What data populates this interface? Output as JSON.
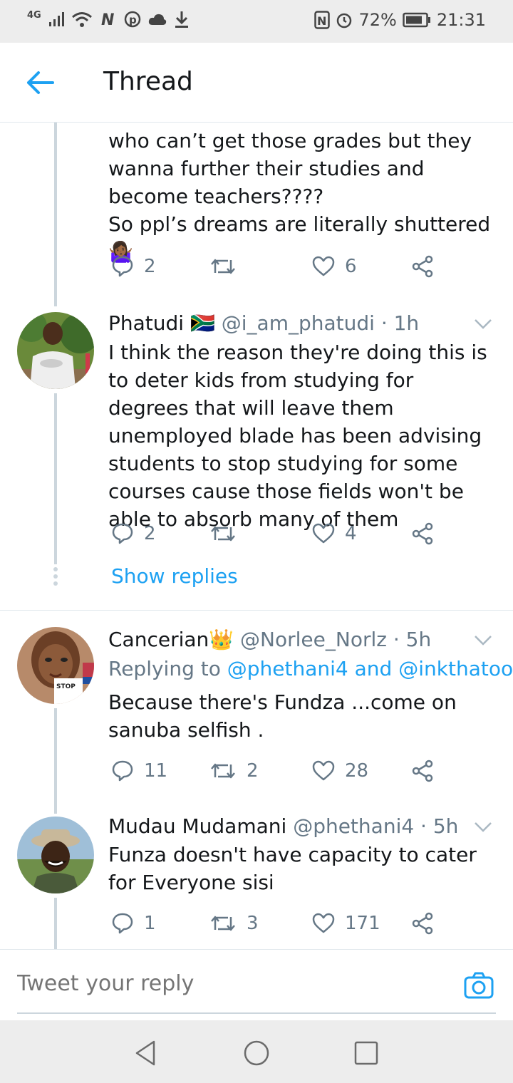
{
  "status_bar": {
    "network": "4G",
    "battery": "72%",
    "time": "21:31"
  },
  "header": {
    "title": "Thread",
    "back_icon": "arrow-left-icon"
  },
  "tweets": [
    {
      "partial": true,
      "text": "who can’t get those grades but they wanna further their studies and become teachers????\nSo ppl’s dreams are literally shuttered 🤷🏾‍♀️",
      "replies": "2",
      "retweets": "",
      "likes": "6"
    },
    {
      "name": "Phatudi 🇿🇦",
      "handle": "@i_am_phatudi · 1h",
      "text": "I think the reason they're doing this is to deter kids from studying for degrees that will leave them unemployed blade has been advising students to stop studying for some courses cause those fields won't be able to absorb many of them",
      "replies": "2",
      "retweets": "",
      "likes": "4",
      "show_replies": "Show replies"
    },
    {
      "name": "Cancerian👑",
      "handle": "@Norlee_Norlz · 5h",
      "replying_prefix": "Replying to",
      "mention_1": "@phethani4",
      "replying_and": "and",
      "mention_2": "@inkthatoo",
      "text": "Because there's Fundza ...come on sanuba selfish  .",
      "replies": "11",
      "retweets": "2",
      "likes": "28"
    },
    {
      "name": "Mudau Mudamani",
      "handle": "@phethani4 · 5h",
      "text": "Funza doesn't have capacity to cater for Everyone sisi",
      "replies": "1",
      "retweets": "3",
      "likes": "171"
    }
  ],
  "composer": {
    "placeholder": "Tweet your reply"
  },
  "colors": {
    "accent": "#1da1f2",
    "muted": "#657786",
    "text": "#14171a",
    "divider": "#e1e8ed"
  }
}
